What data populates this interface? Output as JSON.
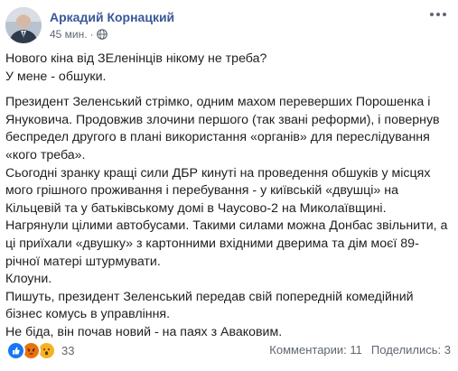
{
  "author": {
    "name": "Аркадий Корнацкий",
    "time": "45 мин.",
    "separator": "·"
  },
  "post": {
    "paragraphs": [
      "Нового кіна від ЗЕленінців нікому не треба?",
      "У мене - обшуки.",
      "Президент Зеленський стрімко, одним махом переверших Порошенка і Януковича. Продовжив злочини першого (так звані реформи), і повернув беспредел другого в плані використання «органів» для переслідування «кого треба».",
      "Сьогодні зранку кращі сили ДБР кинуті на проведення обшуків у місцях мого грішного проживання і перебування - у київській «двушці» на Кільцевій та у батьківському домі в Чаусово-2 на Миколаївщині.",
      "Нагрянули цілими автобусами. Такими силами можна Донбас звільнити, а ці приїхали «двушку» з картонними вхідними дверима та дім моєї 89-річної матері штурмувати.",
      "Клоуни.",
      "Пишуть, президент Зеленський передав свій попередній комедійний бізнес комусь в управління.",
      "Не біда, він почав новий - на паях з Аваковим."
    ]
  },
  "footer": {
    "reaction_count": "33",
    "comments": "Комментарии: 11",
    "shares": "Поделились: 3"
  },
  "colors": {
    "author_link": "#385898",
    "meta_text": "#616770",
    "like_blue": "#1877f2",
    "angry_orange": "#e9710f",
    "wow_yellow": "#f7b125"
  },
  "icons": {
    "privacy": "globe-icon",
    "options": "more-options-icon",
    "reactions": [
      "like-icon",
      "angry-icon",
      "wow-icon"
    ]
  }
}
